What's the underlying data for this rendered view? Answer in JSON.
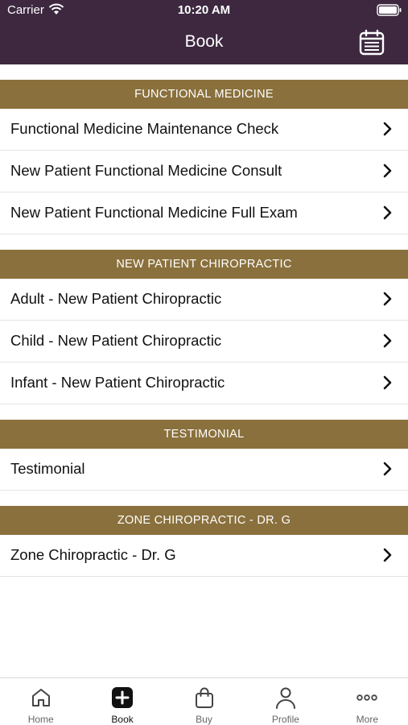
{
  "status_bar": {
    "carrier": "Carrier",
    "time": "10:20 AM"
  },
  "nav": {
    "title": "Book",
    "calendar_icon": "calendar-icon"
  },
  "sections": [
    {
      "header": "FUNCTIONAL MEDICINE",
      "items": [
        {
          "label": "Functional Medicine Maintenance Check"
        },
        {
          "label": "New Patient Functional Medicine Consult"
        },
        {
          "label": "New Patient Functional Medicine Full Exam"
        }
      ]
    },
    {
      "header": "NEW PATIENT CHIROPRACTIC",
      "items": [
        {
          "label": "Adult - New Patient Chiropractic"
        },
        {
          "label": "Child - New Patient Chiropractic"
        },
        {
          "label": "Infant - New Patient Chiropractic"
        }
      ]
    },
    {
      "header": "TESTIMONIAL",
      "items": [
        {
          "label": "Testimonial"
        }
      ]
    },
    {
      "header": "ZONE CHIROPRACTIC - DR. G",
      "items": [
        {
          "label": "Zone Chiropractic - Dr. G"
        }
      ]
    }
  ],
  "tabs": [
    {
      "label": "Home",
      "icon": "home-icon"
    },
    {
      "label": "Book",
      "icon": "plus-square-icon",
      "active": true
    },
    {
      "label": "Buy",
      "icon": "shopping-bag-icon"
    },
    {
      "label": "Profile",
      "icon": "person-icon"
    },
    {
      "label": "More",
      "icon": "more-dots-icon"
    }
  ],
  "colors": {
    "header_bg": "#3d2840",
    "section_bg": "#8a703c"
  }
}
